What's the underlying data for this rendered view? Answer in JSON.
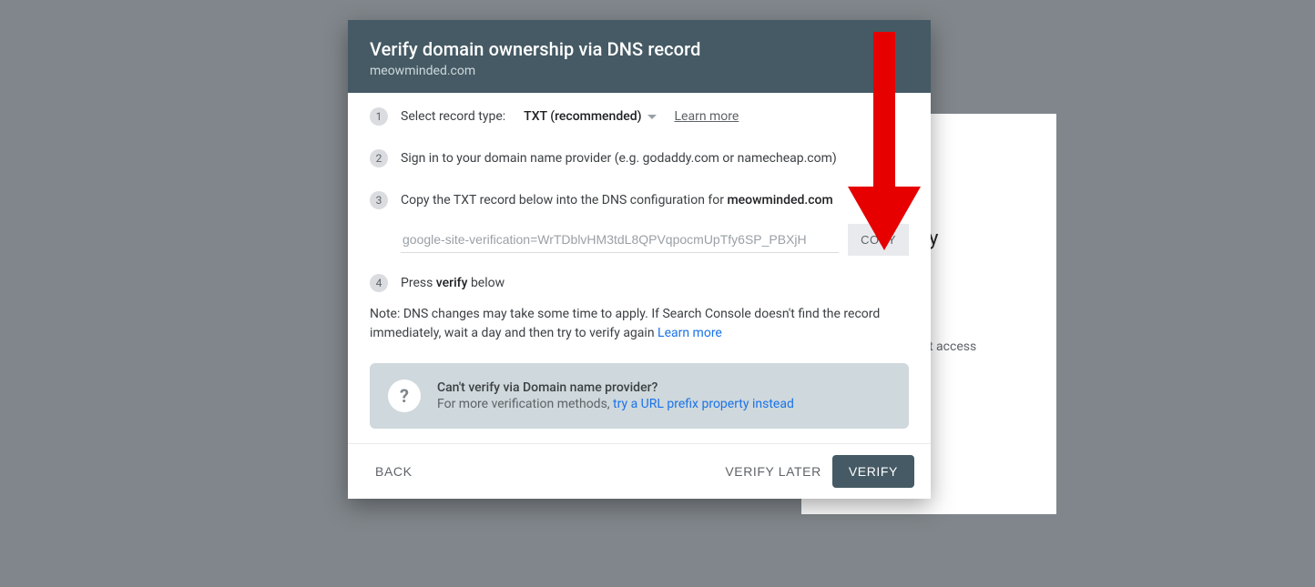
{
  "background": {
    "peek_text_1": "y",
    "peek_text_2": "t access"
  },
  "modal": {
    "header": {
      "title": "Verify domain ownership via DNS record",
      "subtitle": "meowminded.com"
    },
    "step1": {
      "label": "Select record type:",
      "selected": "TXT (recommended)",
      "learn_more": "Learn more"
    },
    "step2": {
      "text": "Sign in to your domain name provider (e.g. godaddy.com or namecheap.com)"
    },
    "step3": {
      "prefix": "Copy the TXT record below into the DNS configuration for ",
      "domain": "meowminded.com",
      "record_value": "google-site-verification=WrTDblvHM3tdL8QPVqpocmUpTfy6SP_PBXjH",
      "copy_label": "COPY"
    },
    "step4": {
      "prefix": "Press ",
      "bold": "verify",
      "suffix": " below"
    },
    "note": {
      "text": "Note: DNS changes may take some time to apply. If Search Console doesn't find the record immediately, wait a day and then try to verify again ",
      "learn_more": "Learn more"
    },
    "cant_verify": {
      "title": "Can't verify via Domain name provider?",
      "sub_prefix": "For more verification methods, ",
      "link": "try a URL prefix property instead"
    },
    "footer": {
      "back": "BACK",
      "verify_later": "VERIFY LATER",
      "verify": "VERIFY"
    }
  }
}
